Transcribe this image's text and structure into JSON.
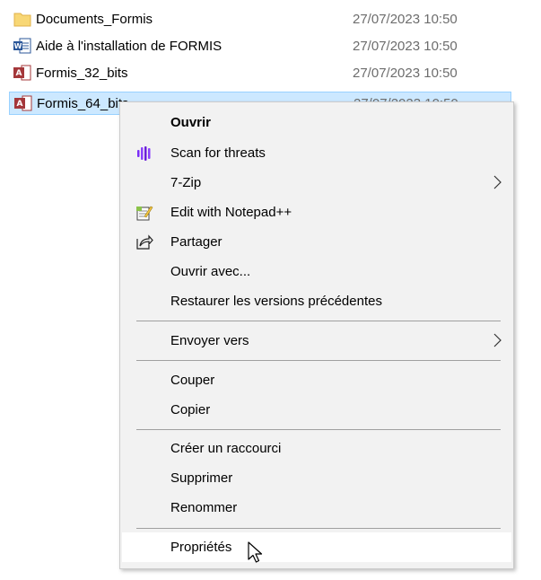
{
  "files": [
    {
      "name": "Documents_Formis",
      "date": "27/07/2023 10:50",
      "icon": "folder-icon"
    },
    {
      "name": "Aide à l'installation de FORMIS",
      "date": "27/07/2023 10:50",
      "icon": "word-document-icon"
    },
    {
      "name": "Formis_32_bits",
      "date": "27/07/2023 10:50",
      "icon": "access-database-icon"
    },
    {
      "name": "Formis_64_bits",
      "date": "27/07/2023 10:50",
      "icon": "access-database-icon",
      "selected": true
    }
  ],
  "context_menu": {
    "open": "Ouvrir",
    "scan": "Scan for threats",
    "sevenzip": "7-Zip",
    "notepad": "Edit with Notepad++",
    "share": "Partager",
    "open_with": "Ouvrir avec...",
    "restore": "Restaurer les versions précédentes",
    "send_to": "Envoyer vers",
    "cut": "Couper",
    "copy": "Copier",
    "create_shortcut": "Créer un raccourci",
    "delete": "Supprimer",
    "rename": "Renommer",
    "properties": "Propriétés"
  },
  "colors": {
    "selection": "#cce8ff",
    "menu_bg": "#f2f2f2",
    "hover": "#ffffff",
    "date_text": "#6d6d6d"
  }
}
